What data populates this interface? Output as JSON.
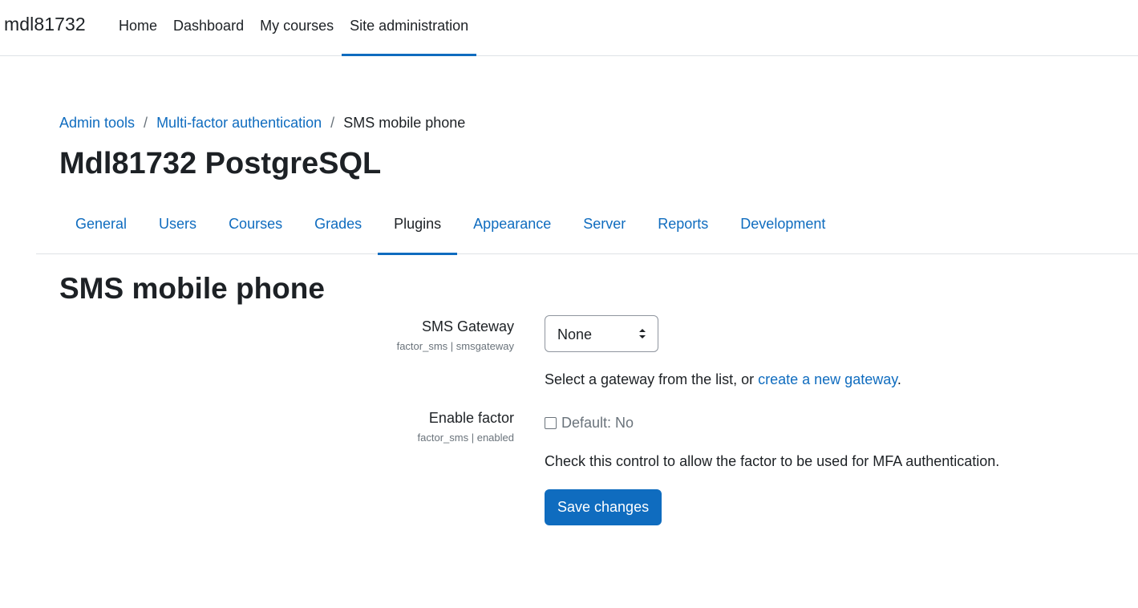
{
  "navbar": {
    "brand": "mdl81732",
    "items": [
      {
        "label": "Home"
      },
      {
        "label": "Dashboard"
      },
      {
        "label": "My courses"
      },
      {
        "label": "Site administration"
      }
    ],
    "active": "Site administration"
  },
  "breadcrumb": {
    "items": [
      "Admin tools",
      "Multi-factor authentication"
    ],
    "separator": "/",
    "current": "SMS mobile phone"
  },
  "site_title": "Mdl81732 PostgreSQL",
  "tabs": {
    "items": [
      {
        "label": "General"
      },
      {
        "label": "Users"
      },
      {
        "label": "Courses"
      },
      {
        "label": "Grades"
      },
      {
        "label": "Plugins"
      },
      {
        "label": "Appearance"
      },
      {
        "label": "Server"
      },
      {
        "label": "Reports"
      },
      {
        "label": "Development"
      }
    ],
    "active": "Plugins"
  },
  "page_heading": "SMS mobile phone",
  "form": {
    "gateway": {
      "label": "SMS Gateway",
      "setting_id": "factor_sms | smsgateway",
      "selected": "None",
      "desc_prefix": "Select a gateway from the list, or ",
      "desc_link": "create a new gateway",
      "desc_suffix": "."
    },
    "enable": {
      "label": "Enable factor",
      "setting_id": "factor_sms | enabled",
      "checked": false,
      "default_text": "Default: No",
      "desc": "Check this control to allow the factor to be used for MFA authentication."
    },
    "save_label": "Save changes"
  },
  "colors": {
    "accent": "#0f6cbf",
    "text": "#1d2125",
    "muted": "#6a737b",
    "border": "#dee2e6"
  }
}
